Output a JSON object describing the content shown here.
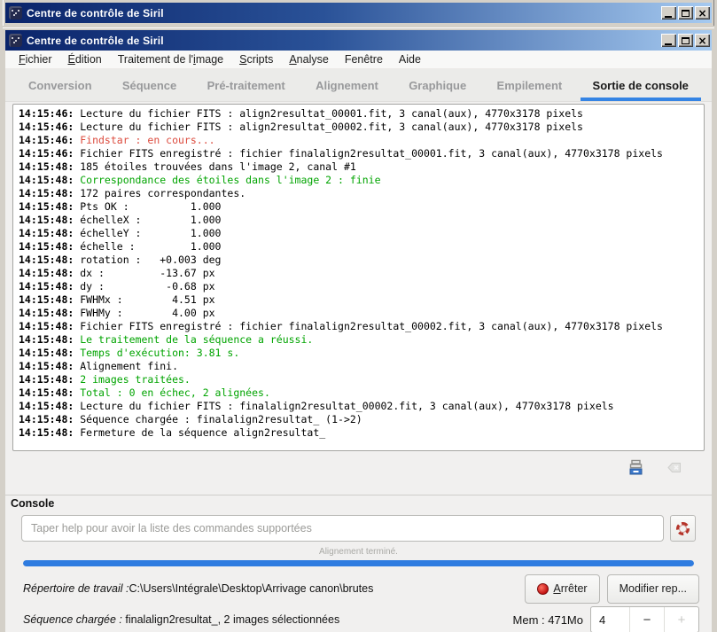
{
  "window": {
    "title": "Centre de contrôle de Siril"
  },
  "icons": {
    "app": "siril-galaxy",
    "minimize": "underscore-bar",
    "maximize": "square-outline",
    "close": "×",
    "export_log": "archive-export",
    "clear_log": "backspace-clear",
    "command_help": "red-lifebuoy",
    "stop": "red-record-dot"
  },
  "colors": {
    "titlebar_left": "#0a246a",
    "titlebar_right": "#a6caf0",
    "accent_blue": "#3584e4",
    "log_red": "#dc4b3e",
    "log_green": "#00a400",
    "progress_blue": "#2f7ce0"
  },
  "menu": {
    "items": [
      {
        "pre": "",
        "key": "F",
        "post": "ichier"
      },
      {
        "pre": "",
        "key": "É",
        "post": "dition"
      },
      {
        "pre": "Traitement de l'",
        "key": "i",
        "post": "mage"
      },
      {
        "pre": "",
        "key": "S",
        "post": "cripts"
      },
      {
        "pre": "",
        "key": "A",
        "post": "nalyse"
      },
      {
        "pre": "Fenêtre",
        "key": "",
        "post": ""
      },
      {
        "pre": "Aide",
        "key": "",
        "post": ""
      }
    ]
  },
  "tabs": {
    "active_tab": "Sortie de console",
    "items": [
      {
        "label": "Conversion",
        "active": "false"
      },
      {
        "label": "Séquence",
        "active": "false"
      },
      {
        "label": "Pré-traitement",
        "active": "false"
      },
      {
        "label": "Alignement",
        "active": "false"
      },
      {
        "label": "Graphique",
        "active": "false"
      },
      {
        "label": "Empilement",
        "active": "false"
      },
      {
        "label": "Sortie de console",
        "active": "true"
      }
    ]
  },
  "console_log": {
    "lines": [
      {
        "t": "14:15:46:",
        "m": " Lecture du fichier FITS : align2resultat_00001.fit, 3 canal(aux), 4770x3178 pixels",
        "c": ""
      },
      {
        "t": "14:15:46:",
        "m": " Lecture du fichier FITS : align2resultat_00002.fit, 3 canal(aux), 4770x3178 pixels",
        "c": ""
      },
      {
        "t": "14:15:46:",
        "m": " Findstar : en cours...",
        "c": "r"
      },
      {
        "t": "14:15:46:",
        "m": " Fichier FITS enregistré : fichier finalalign2resultat_00001.fit, 3 canal(aux), 4770x3178 pixels",
        "c": ""
      },
      {
        "t": "14:15:48:",
        "m": " 185 étoiles trouvées dans l'image 2, canal #1",
        "c": ""
      },
      {
        "t": "14:15:48:",
        "m": " Correspondance des étoiles dans l'image 2 : finie",
        "c": "g"
      },
      {
        "t": "14:15:48:",
        "m": " 172 paires correspondantes.",
        "c": ""
      },
      {
        "t": "14:15:48:",
        "m": " Pts OK :          1.000",
        "c": ""
      },
      {
        "t": "14:15:48:",
        "m": " échelleX :        1.000",
        "c": ""
      },
      {
        "t": "14:15:48:",
        "m": " échelleY :        1.000",
        "c": ""
      },
      {
        "t": "14:15:48:",
        "m": " échelle :         1.000",
        "c": ""
      },
      {
        "t": "14:15:48:",
        "m": " rotation :   +0.003 deg",
        "c": ""
      },
      {
        "t": "14:15:48:",
        "m": " dx :         -13.67 px",
        "c": ""
      },
      {
        "t": "14:15:48:",
        "m": " dy :          -0.68 px",
        "c": ""
      },
      {
        "t": "14:15:48:",
        "m": " FWHMx :        4.51 px",
        "c": ""
      },
      {
        "t": "14:15:48:",
        "m": " FWHMy :        4.00 px",
        "c": ""
      },
      {
        "t": "14:15:48:",
        "m": " Fichier FITS enregistré : fichier finalalign2resultat_00002.fit, 3 canal(aux), 4770x3178 pixels",
        "c": ""
      },
      {
        "t": "14:15:48:",
        "m": " Le traitement de la séquence a réussi.",
        "c": "g"
      },
      {
        "t": "14:15:48:",
        "m": " Temps d'exécution: 3.81 s.",
        "c": "g"
      },
      {
        "t": "14:15:48:",
        "m": " Alignement fini.",
        "c": ""
      },
      {
        "t": "14:15:48:",
        "m": " 2 images traitées.",
        "c": "g"
      },
      {
        "t": "14:15:48:",
        "m": " Total : 0 en échec, 2 alignées.",
        "c": "g"
      },
      {
        "t": "14:15:48:",
        "m": " Lecture du fichier FITS : finalalign2resultat_00002.fit, 3 canal(aux), 4770x3178 pixels",
        "c": ""
      },
      {
        "t": "14:15:48:",
        "m": " Séquence chargée : finalalign2resultat_ (1->2)",
        "c": ""
      },
      {
        "t": "14:15:48:",
        "m": " Fermeture de la séquence align2resultat_",
        "c": ""
      }
    ]
  },
  "console_input": {
    "section_label": "Console",
    "placeholder": "Taper help pour avoir la liste des commandes supportées"
  },
  "progress": {
    "label": "Alignement terminé.",
    "value_pct": 100
  },
  "workdir": {
    "label": "Répertoire de travail :",
    "path": "C:\\Users\\Intégrale\\Desktop\\Arrivage canon\\brutes"
  },
  "buttons": {
    "stop": {
      "pre": "",
      "key": "A",
      "post": "rrêter"
    },
    "change_dir": "Modifier rep..."
  },
  "memory": {
    "label": "Mem : 471Mo"
  },
  "thread_spinner": {
    "value": "4",
    "decrease": "−",
    "increase": "+"
  },
  "sequence": {
    "label": "Séquence chargée :",
    "value": "finalalign2resultat_, 2 images sélectionnées"
  }
}
